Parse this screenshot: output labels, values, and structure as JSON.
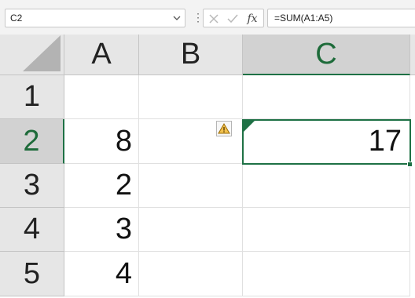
{
  "name_box": {
    "value": "C2"
  },
  "formula_bar": {
    "value": "=SUM(A1:A5)",
    "fx_label": "fx"
  },
  "columns": [
    {
      "label": "A",
      "selected": false
    },
    {
      "label": "B",
      "selected": false
    },
    {
      "label": "C",
      "selected": true
    }
  ],
  "rows": [
    {
      "label": "1",
      "selected": false,
      "cells": {
        "A": "",
        "B": "",
        "C": ""
      }
    },
    {
      "label": "2",
      "selected": true,
      "cells": {
        "A": "8",
        "B": "",
        "C": "17"
      }
    },
    {
      "label": "3",
      "selected": false,
      "cells": {
        "A": "2",
        "B": "",
        "C": ""
      }
    },
    {
      "label": "4",
      "selected": false,
      "cells": {
        "A": "3",
        "B": "",
        "C": ""
      }
    },
    {
      "label": "5",
      "selected": false,
      "cells": {
        "A": "4",
        "B": "",
        "C": ""
      }
    }
  ],
  "active_cell": "C2",
  "colors": {
    "selection": "#1e7145",
    "header_bg": "#e6e6e6",
    "header_selected_bg": "#d2d2d2"
  }
}
